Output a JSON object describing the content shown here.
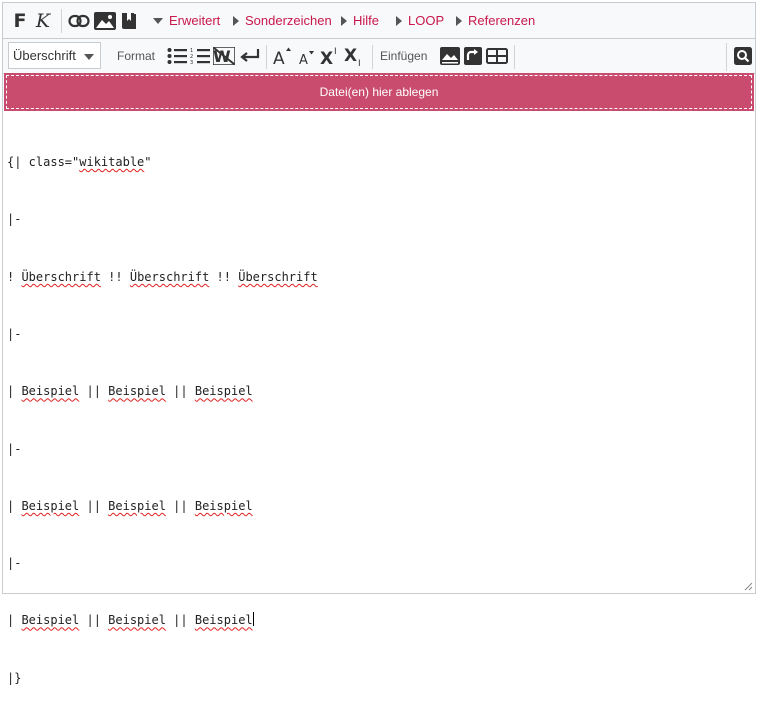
{
  "toolbar": {
    "bold_label": "F",
    "italic_label": "K",
    "menus": [
      {
        "label": "Erweitert",
        "expanded": true
      },
      {
        "label": "Sonderzeichen",
        "expanded": false
      },
      {
        "label": "Hilfe",
        "expanded": false
      },
      {
        "label": "LOOP",
        "expanded": false
      },
      {
        "label": "Referenzen",
        "expanded": false
      }
    ]
  },
  "toolbar2": {
    "heading_select": "Überschrift",
    "format_label": "Format",
    "insert_label": "Einfügen",
    "superscript_label": "X",
    "subscript_label": "X"
  },
  "dropzone": {
    "label": "Datei(en) hier ablegen"
  },
  "editor": {
    "lines": [
      "{| class=\"wikitable\"",
      "|-",
      "! Überschrift !! Überschrift !! Überschrift",
      "|-",
      "| Beispiel || Beispiel || Beispiel",
      "|-",
      "| Beispiel || Beispiel || Beispiel",
      "|-",
      "| Beispiel || Beispiel || Beispiel",
      "|}"
    ]
  },
  "colors": {
    "accent": "#c8184c",
    "dropzone": "#c94c6e"
  }
}
